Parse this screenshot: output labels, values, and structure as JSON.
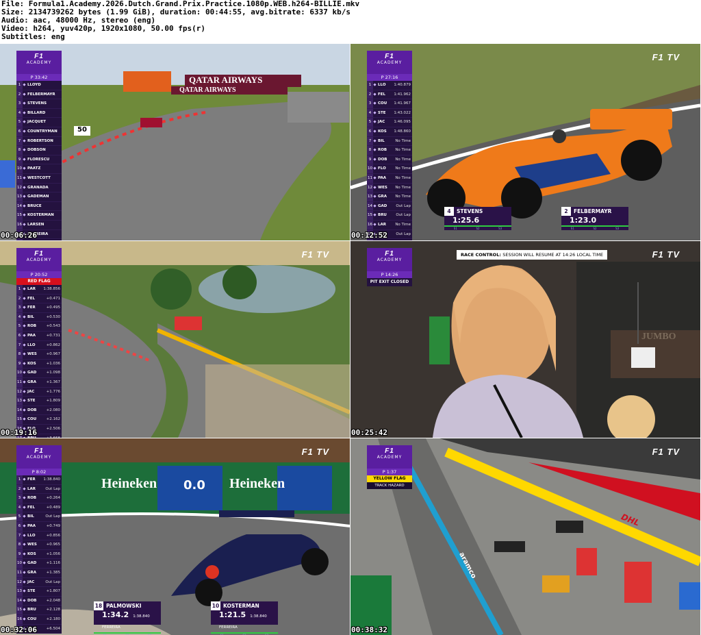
{
  "header": {
    "file_line": "File: Formula1.Academy.2026.Dutch.Grand.Prix.Practice.1080p.WEB.h264-BILLIE.mkv",
    "size_line": "Size: 2134739262 bytes (1.99 GiB), duration: 00:44:55, avg.bitrate: 6337 kb/s",
    "audio_line": "Audio: aac, 48000 Hz, stereo (eng)",
    "video_line": "Video: h264, yuv420p, 1920x1080, 50.00 fps(r)",
    "subs_line": "Subtitles: eng"
  },
  "brand": {
    "logo": "F1",
    "sub": "ACADEMY",
    "tv": "F1 TV"
  },
  "frames": [
    {
      "timestamp": "00:06:26",
      "timer": "P 33:42",
      "rows": [
        {
          "pos": "1",
          "name": "LLOYD",
          "gap": ""
        },
        {
          "pos": "2",
          "name": "FELBERMAYR",
          "gap": ""
        },
        {
          "pos": "3",
          "name": "STEVENS",
          "gap": ""
        },
        {
          "pos": "4",
          "name": "BILLARD",
          "gap": ""
        },
        {
          "pos": "5",
          "name": "JACQUET",
          "gap": ""
        },
        {
          "pos": "6",
          "name": "COUNTRYMAN",
          "gap": ""
        },
        {
          "pos": "7",
          "name": "ROBERTSON",
          "gap": ""
        },
        {
          "pos": "8",
          "name": "DOBSON",
          "gap": ""
        },
        {
          "pos": "9",
          "name": "FLORESCU",
          "gap": ""
        },
        {
          "pos": "10",
          "name": "PAATZ",
          "gap": ""
        },
        {
          "pos": "11",
          "name": "WESTCOTT",
          "gap": ""
        },
        {
          "pos": "12",
          "name": "GRANADA",
          "gap": ""
        },
        {
          "pos": "13",
          "name": "GADEMAN",
          "gap": ""
        },
        {
          "pos": "14",
          "name": "BRUCE",
          "gap": ""
        },
        {
          "pos": "15",
          "name": "KOSTERMAN",
          "gap": ""
        },
        {
          "pos": "16",
          "name": "LARSEN",
          "gap": ""
        },
        {
          "pos": "17",
          "name": "FERREIRA",
          "gap": ""
        },
        {
          "pos": "18",
          "name": "PALMOWSKI",
          "gap": ""
        }
      ],
      "scene": {
        "sponsor": "QATAR AIRWAYS",
        "board_number": "50"
      }
    },
    {
      "timestamp": "00:12:52",
      "timer": "P 27:16",
      "rows": [
        {
          "pos": "1",
          "name": "LLO",
          "gap": "1:40.879"
        },
        {
          "pos": "2",
          "name": "FEL",
          "gap": "1:41.962"
        },
        {
          "pos": "3",
          "name": "COU",
          "gap": "1:41.967"
        },
        {
          "pos": "4",
          "name": "STE",
          "gap": "1:43.022"
        },
        {
          "pos": "5",
          "name": "JAC",
          "gap": "1:46.095"
        },
        {
          "pos": "6",
          "name": "KOS",
          "gap": "1:48.860"
        },
        {
          "pos": "7",
          "name": "BIL",
          "gap": "No Time"
        },
        {
          "pos": "8",
          "name": "ROB",
          "gap": "No Time"
        },
        {
          "pos": "9",
          "name": "DOB",
          "gap": "No Time"
        },
        {
          "pos": "10",
          "name": "FLO",
          "gap": "No Time"
        },
        {
          "pos": "11",
          "name": "PAA",
          "gap": "No Time"
        },
        {
          "pos": "12",
          "name": "WES",
          "gap": "No Time"
        },
        {
          "pos": "13",
          "name": "GRA",
          "gap": "No Time"
        },
        {
          "pos": "14",
          "name": "GAD",
          "gap": "Out Lap"
        },
        {
          "pos": "15",
          "name": "BRU",
          "gap": "Out Lap"
        },
        {
          "pos": "16",
          "name": "LAR",
          "gap": "No Time"
        },
        {
          "pos": "17",
          "name": "FER",
          "gap": "Out Lap"
        },
        {
          "pos": "18",
          "name": "PAL",
          "gap": "No Time"
        }
      ],
      "laps": [
        {
          "pos": "4",
          "name": "STEVENS",
          "time": "1:25.6",
          "note": ""
        },
        {
          "pos": "2",
          "name": "FELBERMAYR",
          "time": "1:23.0",
          "note": ""
        }
      ]
    },
    {
      "timestamp": "00:19:16",
      "timer": "P 20:52",
      "flag": "RED FLAG",
      "rows": [
        {
          "pos": "1",
          "name": "LAR",
          "gap": "1:38.856"
        },
        {
          "pos": "2",
          "name": "FEL",
          "gap": "+0.471"
        },
        {
          "pos": "3",
          "name": "FER",
          "gap": "+0.495"
        },
        {
          "pos": "4",
          "name": "BIL",
          "gap": "+0.530"
        },
        {
          "pos": "5",
          "name": "ROB",
          "gap": "+0.543"
        },
        {
          "pos": "6",
          "name": "PAA",
          "gap": "+0.731"
        },
        {
          "pos": "7",
          "name": "LLO",
          "gap": "+0.862"
        },
        {
          "pos": "8",
          "name": "WES",
          "gap": "+0.967"
        },
        {
          "pos": "9",
          "name": "KOS",
          "gap": "+1.036"
        },
        {
          "pos": "10",
          "name": "GAD",
          "gap": "+1.098"
        },
        {
          "pos": "11",
          "name": "GRA",
          "gap": "+1.367"
        },
        {
          "pos": "12",
          "name": "JAC",
          "gap": "+1.776"
        },
        {
          "pos": "13",
          "name": "STE",
          "gap": "+1.809"
        },
        {
          "pos": "14",
          "name": "DOB",
          "gap": "+2.080"
        },
        {
          "pos": "15",
          "name": "COU",
          "gap": "+2.162"
        },
        {
          "pos": "16",
          "name": "FLO",
          "gap": "+2.506"
        },
        {
          "pos": "17",
          "name": "BRU",
          "gap": "+3.668"
        },
        {
          "pos": "18",
          "name": "PAL",
          "gap": "No Time"
        }
      ]
    },
    {
      "timestamp": "00:25:42",
      "timer": "P 14:26",
      "flag": "PIT EXIT CLOSED",
      "banner_label": "RACE CONTROL:",
      "banner_text": "SESSION WILL RESUME AT 14:26 LOCAL TIME",
      "scene": {
        "wall_text": "JUMBO"
      }
    },
    {
      "timestamp": "00:32:06",
      "timer": "P 8:02",
      "rows": [
        {
          "pos": "1",
          "name": "FER",
          "gap": "1:38.840"
        },
        {
          "pos": "2",
          "name": "LAR",
          "gap": "Out Lap"
        },
        {
          "pos": "3",
          "name": "ROB",
          "gap": "+0.264"
        },
        {
          "pos": "4",
          "name": "FEL",
          "gap": "+0.489"
        },
        {
          "pos": "5",
          "name": "BIL",
          "gap": "Out Lap"
        },
        {
          "pos": "6",
          "name": "PAA",
          "gap": "+0.749"
        },
        {
          "pos": "7",
          "name": "LLO",
          "gap": "+0.856"
        },
        {
          "pos": "8",
          "name": "WES",
          "gap": "+0.965"
        },
        {
          "pos": "9",
          "name": "KOS",
          "gap": "+1.056"
        },
        {
          "pos": "10",
          "name": "GAD",
          "gap": "+1.116"
        },
        {
          "pos": "11",
          "name": "GRA",
          "gap": "+1.385"
        },
        {
          "pos": "12",
          "name": "JAC",
          "gap": "Out Lap"
        },
        {
          "pos": "13",
          "name": "STE",
          "gap": "+1.807"
        },
        {
          "pos": "14",
          "name": "DOB",
          "gap": "+2.048"
        },
        {
          "pos": "15",
          "name": "BRU",
          "gap": "+2.128"
        },
        {
          "pos": "16",
          "name": "COU",
          "gap": "+2.180"
        },
        {
          "pos": "17",
          "name": "PAL",
          "gap": "+6.504"
        }
      ],
      "laps": [
        {
          "pos": "18",
          "name": "PALMOWSKI",
          "time": "1:34.2",
          "note": "1:38.840 FERREIRA"
        },
        {
          "pos": "10",
          "name": "KOSTERMAN",
          "time": "1:21.5",
          "note": "1:38.840 FERREIRA"
        }
      ],
      "scene": {
        "sponsor": "Heineken",
        "board": "0.0"
      }
    },
    {
      "timestamp": "00:38:32",
      "timer": "P 1:37",
      "flag": "YELLOW FLAG",
      "flag_sub": "TRACK HAZARD",
      "scene": {
        "sponsor_pit": "DHL",
        "kerb_text": "aramco"
      }
    }
  ]
}
